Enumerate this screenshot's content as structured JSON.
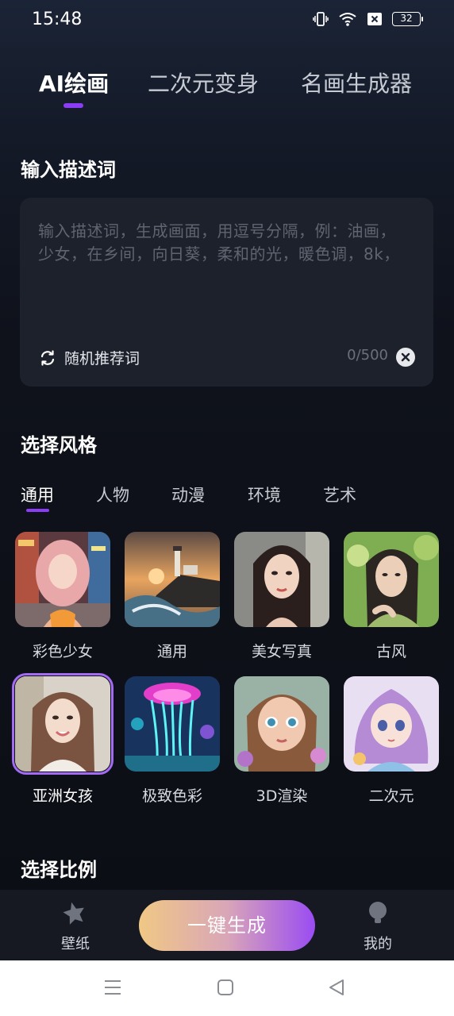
{
  "status_bar": {
    "time": "15:48",
    "battery": "32"
  },
  "top_tabs": [
    {
      "label": "AI绘画",
      "active": true
    },
    {
      "label": "二次元变身",
      "active": false
    },
    {
      "label": "名画生成器",
      "active": false
    }
  ],
  "prompt_section": {
    "title": "输入描述词",
    "placeholder": "输入描述词，生成画面，用逗号分隔，例：油画，少女，在乡间，向日葵，柔和的光，暖色调，8k，",
    "random_label": "随机推荐词",
    "char_count": "0/500"
  },
  "style_section": {
    "title": "选择风格",
    "tabs": [
      {
        "label": "通用",
        "active": true
      },
      {
        "label": "人物",
        "active": false
      },
      {
        "label": "动漫",
        "active": false
      },
      {
        "label": "环境",
        "active": false
      },
      {
        "label": "艺术",
        "active": false
      }
    ],
    "items": [
      {
        "label": "彩色少女",
        "selected": false
      },
      {
        "label": "通用",
        "selected": false
      },
      {
        "label": "美女写真",
        "selected": false
      },
      {
        "label": "古风",
        "selected": false
      },
      {
        "label": "亚洲女孩",
        "selected": true
      },
      {
        "label": "极致色彩",
        "selected": false
      },
      {
        "label": "3D渲染",
        "selected": false
      },
      {
        "label": "二次元",
        "selected": false
      }
    ]
  },
  "ratio_section": {
    "title": "选择比例"
  },
  "bottom_nav": {
    "wallpaper_label": "壁纸",
    "generate_label": "一键生成",
    "mine_label": "我的"
  },
  "colors": {
    "accent": "#8b3df5",
    "background": "#0c0e15",
    "panel": "#1d212b"
  }
}
